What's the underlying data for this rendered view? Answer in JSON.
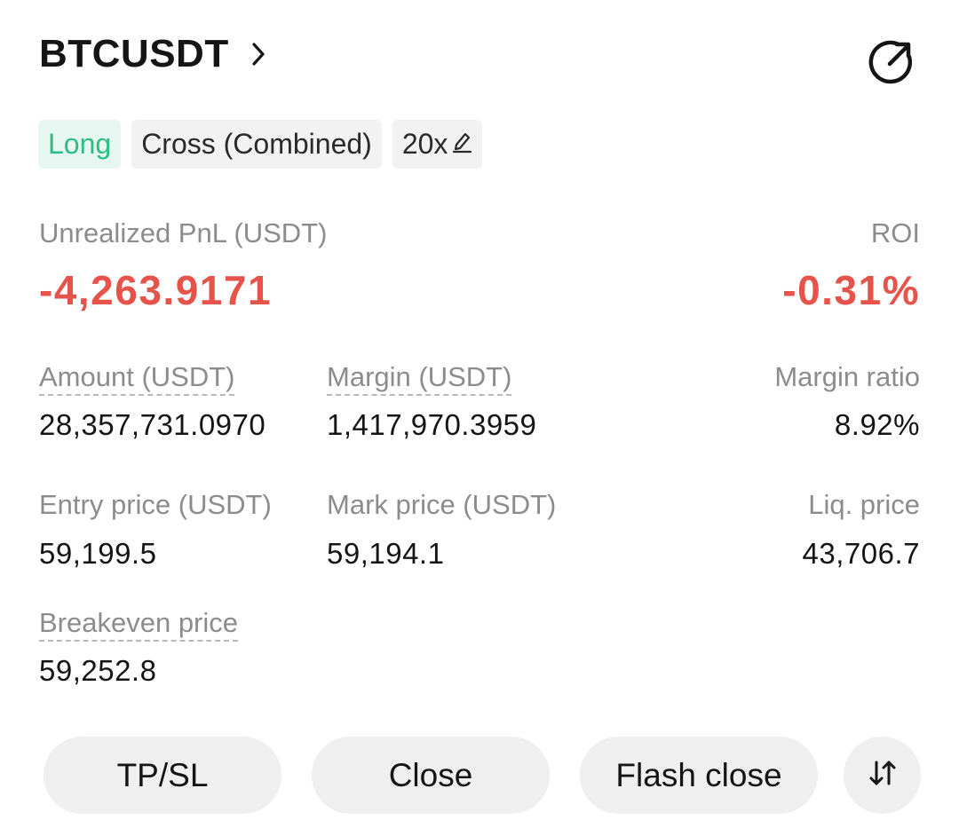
{
  "header": {
    "symbol": "BTCUSDT"
  },
  "tags": {
    "side": "Long",
    "margin_mode": "Cross (Combined)",
    "leverage": "20x"
  },
  "pnl": {
    "label": "Unrealized PnL (USDT)",
    "value": "-4,263.9171",
    "roi_label": "ROI",
    "roi_value": "-0.31%"
  },
  "stats": {
    "amount_label": "Amount (USDT)",
    "amount_value": "28,357,731.0970",
    "margin_label": "Margin (USDT)",
    "margin_value": "1,417,970.3959",
    "margin_ratio_label": "Margin ratio",
    "margin_ratio_value": "8.92%",
    "entry_label": "Entry price (USDT)",
    "entry_value": "59,199.5",
    "mark_label": "Mark price (USDT)",
    "mark_value": "59,194.1",
    "liq_label": "Liq. price",
    "liq_value": "43,706.7",
    "breakeven_label": "Breakeven price",
    "breakeven_value": "59,252.8"
  },
  "actions": {
    "tpsl": "TP/SL",
    "close": "Close",
    "flash_close": "Flash close"
  },
  "colors": {
    "long_green": "#2ebd85",
    "loss_red": "#e5534b",
    "label_gray": "#8c8c8c"
  },
  "icons": {
    "header_chevron": "chevron-right-icon",
    "share": "share-icon",
    "edit_leverage": "pencil-icon",
    "reverse": "reverse-position-icon"
  }
}
